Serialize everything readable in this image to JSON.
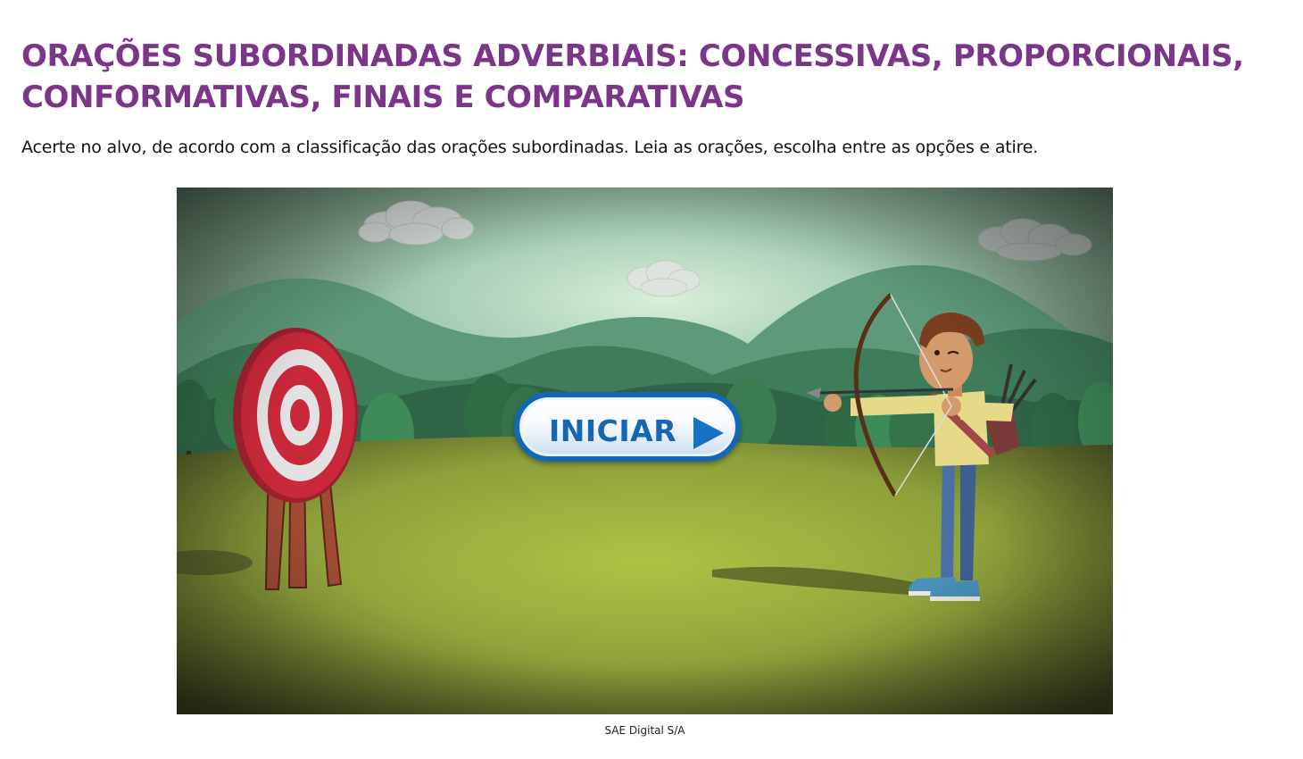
{
  "page": {
    "title": "ORAÇÕES SUBORDINADAS ADVERBIAIS: CONCESSIVAS, PROPORCIONAIS, CONFORMATIVAS, FINAIS E COMPARATIVAS",
    "instructions": "Acerte no alvo, de acordo com a classificação das orações subordinadas. Leia as orações, escolha entre as opções e atire.",
    "credit": "SAE Digital S/A"
  },
  "game": {
    "start_label": "INICIAR",
    "start_icon": "play-arrow-icon"
  },
  "colors": {
    "title": "#7b3589",
    "button_blue": "#1467b6",
    "target_red": "#c8283a",
    "grass": "#a9b93f",
    "sky": "#b7dcc4"
  }
}
